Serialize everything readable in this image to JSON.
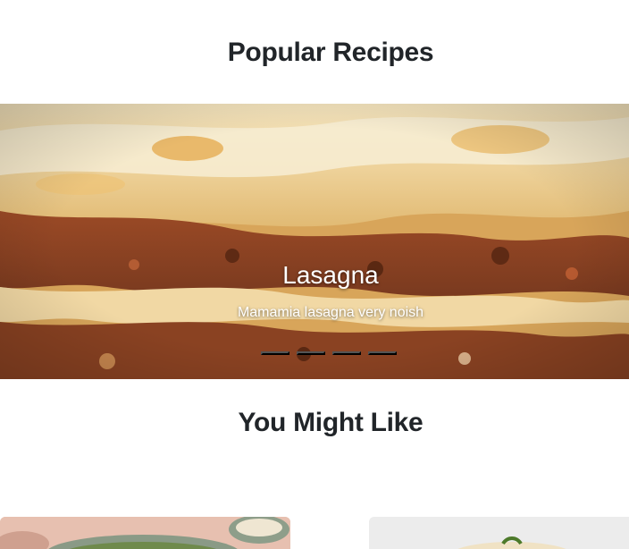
{
  "sections": {
    "popular_title": "Popular Recipes",
    "like_title": "You Might Like"
  },
  "carousel": {
    "active_index": 1,
    "slide_count": 4,
    "slides": [
      {
        "title": "Lasagna",
        "caption": "Mamamia lasagna very noish"
      }
    ]
  },
  "colors": {
    "heading": "#212529",
    "caption": "#ffffff"
  }
}
